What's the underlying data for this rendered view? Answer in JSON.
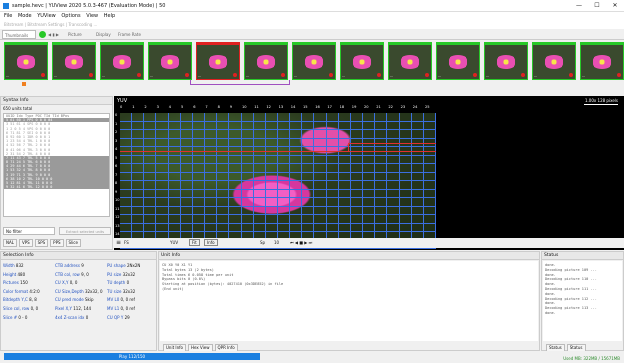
{
  "window": {
    "title": "sample.hevc | YUView 2020 5.0.3-467 (Evaluation Mode) | 50",
    "minimize": "—",
    "maximize": "☐",
    "close": "✕"
  },
  "menu": [
    "File",
    "Mode",
    "YUView",
    "Options",
    "View",
    "Help"
  ],
  "subbar": "Bitstream | Bitstream Settings | Transcoding ...",
  "toolbar": {
    "thumbnails": "Thumbnails",
    "picture": "Picture",
    "display": "Display",
    "frame_rate": "Frame Rate"
  },
  "thumbnails": [
    {
      "label": "...",
      "dot": "#e02020",
      "border": "#27c827"
    },
    {
      "label": "...",
      "dot": "#e02020",
      "border": "#27c827"
    },
    {
      "label": "...",
      "dot": "#e02020",
      "border": "#27c827"
    },
    {
      "label": "...",
      "dot": "#e02020",
      "border": "#27c827"
    },
    {
      "label": "...",
      "dot": "#e02020",
      "border": "#e02020"
    },
    {
      "label": "...",
      "dot": "#e02020",
      "border": "#27c827"
    },
    {
      "label": "...",
      "dot": "#e02020",
      "border": "#27c827"
    },
    {
      "label": "...",
      "dot": "#e02020",
      "border": "#27c827"
    },
    {
      "label": "...",
      "dot": "#e02020",
      "border": "#27c827"
    },
    {
      "label": "...",
      "dot": "#e02020",
      "border": "#27c827"
    },
    {
      "label": "...",
      "dot": "#e02020",
      "border": "#27c827"
    },
    {
      "label": "...",
      "dot": "#e02020",
      "border": "#27c827"
    },
    {
      "label": "...",
      "dot": "#e02020",
      "border": "#27c827"
    }
  ],
  "syntax_info": {
    "header": "Syntax Info",
    "count": "650 units total",
    "columns": "UUID Idx Type POC  TId TId BPos",
    "rows": [
      {
        "text": "5 61 60 1  PPS  0  0  0  04",
        "sel": true
      },
      {
        "text": "3 51 61 4  SPS  0  0  0  0",
        "sel": false
      },
      {
        "text": "1 2 0 5 4  VPS  0  0  0  0",
        "sel": false
      },
      {
        "text": "6 71 81 7  SEI  0  0  0  0",
        "sel": false
      },
      {
        "text": "8 92 60 1  IDR  0  0  0  1",
        "sel": false
      },
      {
        "text": "1 23 54 4  TRL  1  0  0  0",
        "sel": false
      },
      {
        "text": "4 52 56 7  TRL  2  0  0  0",
        "sel": false
      },
      {
        "text": "0 41 06 4  TRL  3  0  0  0",
        "sel": false
      },
      {
        "text": "2 31 54 2  TRL  4  0  0  0",
        "sel": false
      },
      {
        "text": "7 11 43 7  TRL  5  0  0  0",
        "sel": true
      },
      {
        "text": "8 71 24 5  TRL  6  0  0  0",
        "sel": true
      },
      {
        "text": "4 29 44 6  TRL  7  0  0  0",
        "sel": true
      },
      {
        "text": "1 53 32 4  TRL  8  0  0  0",
        "sel": true
      },
      {
        "text": "3 19 71 3  TRL  9  0  0  0",
        "sel": true
      },
      {
        "text": "6 38 10 2  TRL  10 0  0  0",
        "sel": true
      },
      {
        "text": "5 12 81 4  TRL  11 0  0  0",
        "sel": true
      },
      {
        "text": "9 32 41 6  TRL  12 0  0  0",
        "sel": true
      }
    ],
    "filter_placeholder": "No filter",
    "extract_btn": "Extract selected units",
    "tabs": [
      "NAL",
      "VPS",
      "SPS",
      "PPS",
      "Slice"
    ]
  },
  "viewer": {
    "label": "YUV",
    "scale": "1.00x   128 pixels",
    "column_numbers": [
      "0",
      "1",
      "2",
      "3",
      "4",
      "5",
      "6",
      "7",
      "8",
      "9",
      "10",
      "11",
      "12",
      "13",
      "14",
      "15",
      "16",
      "17",
      "18",
      "19",
      "20",
      "21",
      "22",
      "23",
      "24",
      "25"
    ],
    "row_numbers": [
      "0",
      "1",
      "2",
      "3",
      "4",
      "5",
      "6",
      "7",
      "8",
      "9",
      "10",
      "11",
      "12",
      "13",
      "14",
      "15"
    ],
    "controls": {
      "fs": "FS",
      "yuv": "YUV",
      "fit": "Fit",
      "info": "Info",
      "sp": "Sp",
      "frame": "10"
    }
  },
  "selection_info": {
    "header": "Selection Info",
    "col1": [
      {
        "k": "Width",
        "v": "832"
      },
      {
        "k": "Height",
        "v": "480"
      },
      {
        "k": "Pictures",
        "v": "150"
      },
      {
        "k": "Color format",
        "v": "4:2:0"
      },
      {
        "k": "Bitdepth Y,C",
        "v": "8, 8"
      },
      {
        "k": "Slice col, row",
        "v": "0, 0"
      },
      {
        "k": "Slice #",
        "v": "0 - 0"
      }
    ],
    "col2": [
      {
        "k": "CTB address",
        "v": "9"
      },
      {
        "k": "CTB col, row",
        "v": "9, 0"
      },
      {
        "k": "CU X,Y",
        "v": "0, 0"
      },
      {
        "k": "CU Size,Depth",
        "v": "32x32, 0"
      },
      {
        "k": "CU pred mode",
        "v": "Skip"
      },
      {
        "k": "Pixel X,Y",
        "v": "112, 144"
      },
      {
        "k": "4x4 Z-scan idx",
        "v": "0"
      }
    ],
    "col3": [
      {
        "k": "PU shape",
        "v": "2Nx2N"
      },
      {
        "k": "PU size",
        "v": "32x32"
      },
      {
        "k": "TU depth",
        "v": "0"
      },
      {
        "k": "TU size",
        "v": "32x32"
      },
      {
        "k": "MV L0",
        "v": "0, 0 ref"
      },
      {
        "k": "MV L1",
        "v": "0, 0 ref"
      },
      {
        "k": "CU QP Y",
        "v": "29"
      }
    ]
  },
  "unit_info": {
    "header": "Unit Info",
    "lines": [
      "CU X0 Y0 X1 Y1",
      "Total bytes 13 (2 bytes)",
      "Total times 6 0.058 time per unit",
      "Bypass bits 0 (0.0%)",
      "Starting at position (bytes): 4027410 (0x3DE852) in file",
      "(End unit)"
    ],
    "tabs": [
      "Unit Info",
      "Hex View",
      "QPR Info"
    ]
  },
  "status": {
    "header": "Status",
    "lines": [
      "done.",
      "Decoding picture 109 ...",
      "done.",
      "Decoding picture 110 ...",
      "done.",
      "Decoding picture 111 ...",
      "done.",
      "Decoding picture 112 ...",
      "done.",
      "Decoding picture 113 ...",
      "done."
    ],
    "tabs": [
      "Status",
      "Status"
    ]
  },
  "footer": {
    "progress": "Play 112/150",
    "memory": "Used MB: 322MB / 15671MB"
  },
  "colors": {
    "accent": "#1a7fe0",
    "grid": "#3b6fe0",
    "ctb_red": "#e03030",
    "thumb_green": "#27c827"
  }
}
